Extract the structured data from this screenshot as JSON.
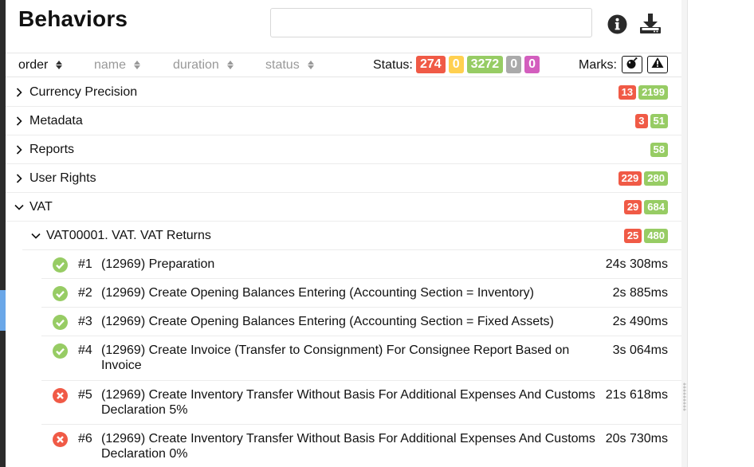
{
  "header": {
    "title": "Behaviors",
    "search_value": "",
    "search_placeholder": ""
  },
  "icons": {
    "info": "info-circle-icon",
    "download": "download-icon",
    "bomb": "bomb-icon",
    "warning": "warning-triangle-icon"
  },
  "sort": {
    "order": "order",
    "name": "name",
    "duration": "duration",
    "status": "status"
  },
  "status_filter": {
    "label": "Status:",
    "failed": "274",
    "broken": "0",
    "passed": "3272",
    "skipped": "0",
    "unknown": "0"
  },
  "marks_label": "Marks:",
  "colors": {
    "failed": "#f05a46",
    "broken": "#ffd050",
    "passed": "#97cc64",
    "skipped": "#aaaaaa",
    "unknown": "#d35ebe"
  },
  "groups": [
    {
      "label": "Currency Precision",
      "failed": "13",
      "passed": "2199",
      "expanded": false
    },
    {
      "label": "Metadata",
      "failed": "3",
      "passed": "51",
      "expanded": false
    },
    {
      "label": "Reports",
      "failed": "",
      "passed": "58",
      "expanded": false
    },
    {
      "label": "User Rights",
      "failed": "229",
      "passed": "280",
      "expanded": false
    },
    {
      "label": "VAT",
      "failed": "29",
      "passed": "684",
      "expanded": true
    }
  ],
  "subgroup": {
    "label": "VAT00001. VAT. VAT Returns",
    "failed": "25",
    "passed": "480",
    "expanded": true
  },
  "cases": [
    {
      "num": "#1",
      "name": "(12969) Preparation",
      "duration": "24s 308ms",
      "status": "passed"
    },
    {
      "num": "#2",
      "name": "(12969) Create Opening Balances Entering (Accounting Section = Inventory)",
      "duration": "2s 885ms",
      "status": "passed"
    },
    {
      "num": "#3",
      "name": "(12969) Create Opening Balances Entering (Accounting Section = Fixed Assets)",
      "duration": "2s 490ms",
      "status": "passed"
    },
    {
      "num": "#4",
      "name": "(12969) Create Invoice (Transfer to Consignment) For Consignee Report Based on Invoice",
      "duration": "3s 064ms",
      "status": "passed"
    },
    {
      "num": "#5",
      "name": "(12969) Create Inventory Transfer Without Basis For Additional Expenses And Customs Declaration 5%",
      "duration": "21s 618ms",
      "status": "failed"
    },
    {
      "num": "#6",
      "name": "(12969) Create Inventory Transfer Without Basis For Additional Expenses And Customs Declaration 0%",
      "duration": "20s 730ms",
      "status": "failed"
    }
  ]
}
